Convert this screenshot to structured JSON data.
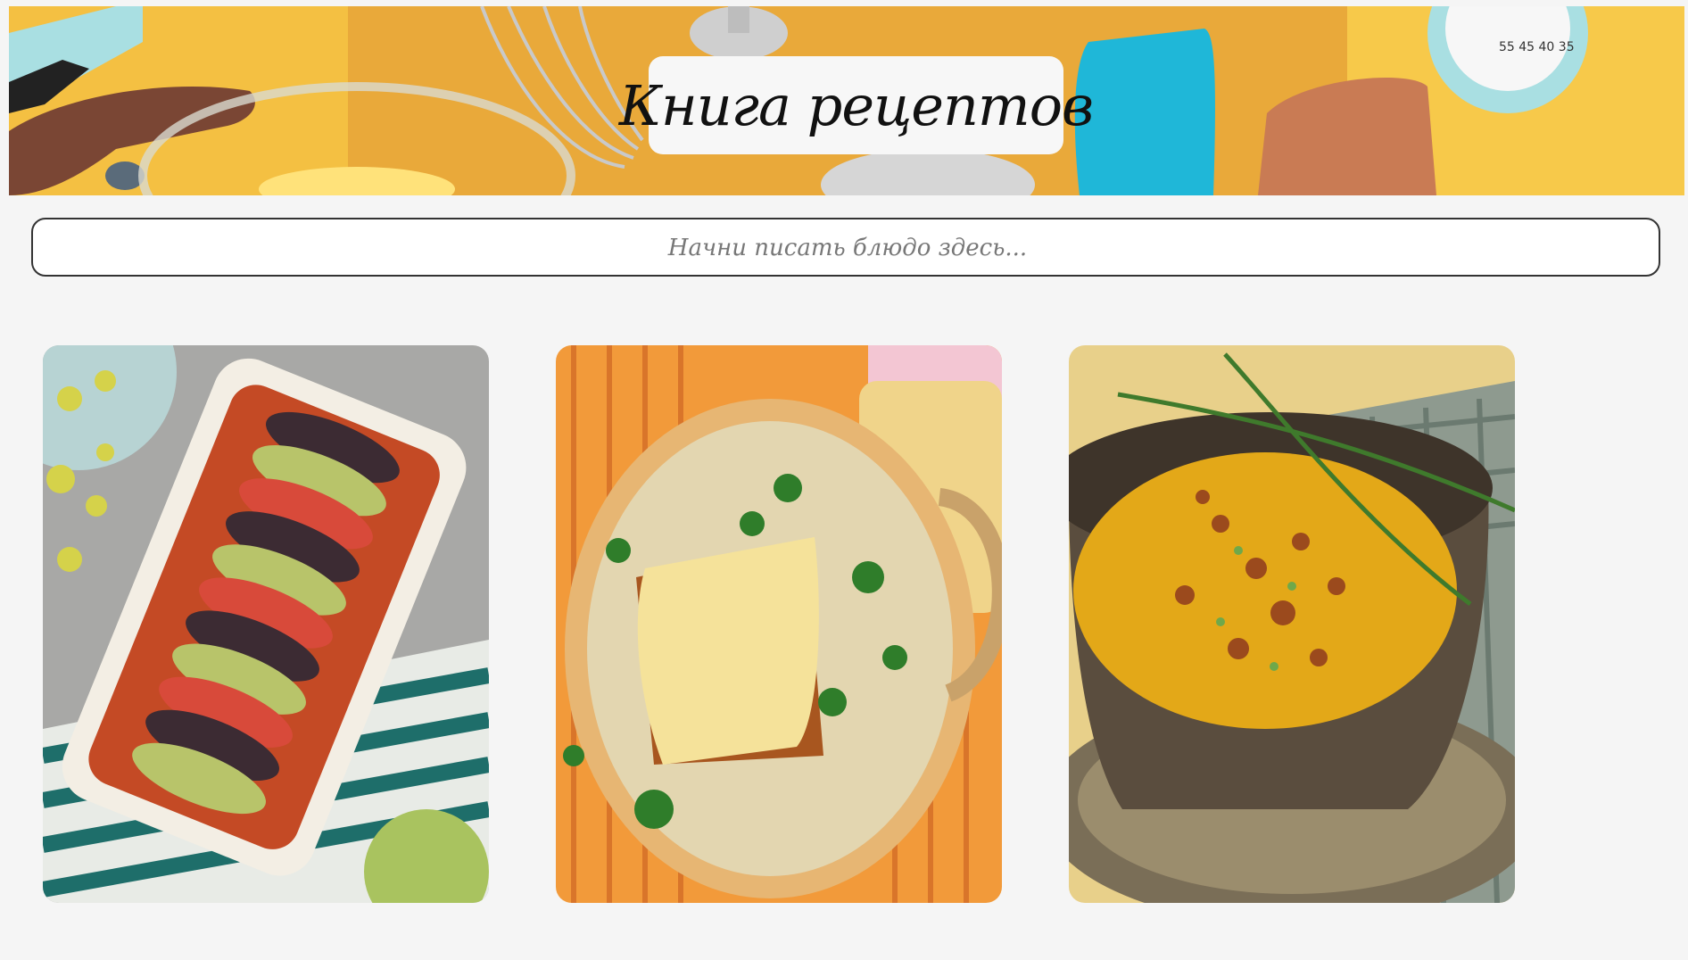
{
  "header": {
    "title": "Книга рецептов"
  },
  "search": {
    "placeholder": "Начни писать блюдо здесь..."
  },
  "recipes": [
    {
      "image": "ratatouille-photo-icon"
    },
    {
      "image": "onion-soup-photo-icon"
    },
    {
      "image": "cream-soup-photo-icon"
    }
  ],
  "colors": {
    "page_background": "#f5f5f5",
    "banner_yellow": "#f2bd3c",
    "input_border": "#333333"
  }
}
